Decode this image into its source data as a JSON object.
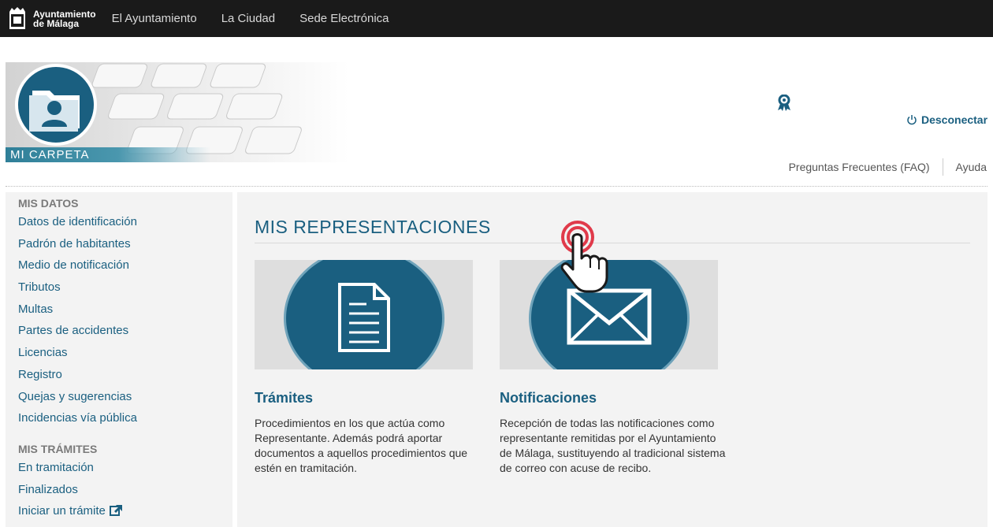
{
  "topbar": {
    "logo_line1": "Ayuntamiento",
    "logo_line2": "de Málaga",
    "nav": [
      "El Ayuntamiento",
      "La Ciudad",
      "Sede Electrónica"
    ]
  },
  "banner": {
    "label": "MI CARPETA"
  },
  "header": {
    "logout": "Desconectar",
    "faq": "Preguntas Frecuentes (FAQ)",
    "help": "Ayuda"
  },
  "sidebar": {
    "section1": "MIS DATOS",
    "items1": [
      "Datos de identificación",
      "Padrón de habitantes",
      "Medio de notificación",
      "Tributos",
      "Multas",
      "Partes de accidentes",
      "Licencias",
      "Registro",
      "Quejas y sugerencias",
      "Incidencias vía pública"
    ],
    "section2": "MIS TRÁMITES",
    "items2": [
      "En tramitación",
      "Finalizados",
      "Iniciar un trámite"
    ]
  },
  "main": {
    "title": "MIS REPRESENTACIONES",
    "cards": [
      {
        "title": "Trámites",
        "desc": "Procedimientos en los que actúa como Representante. Además podrá aportar documentos a aquellos procedimientos que estén en tramitación.",
        "icon": "document-icon"
      },
      {
        "title": "Notificaciones",
        "desc": "Recepción de todas las notificaciones como representante remitidas por el Ayuntamiento de Málaga, sustituyendo al tradicional sistema de correo con acuse de recibo.",
        "icon": "envelope-icon"
      }
    ]
  },
  "colors": {
    "brand": "#1a5f80",
    "topbar": "#1a1a1a",
    "panel": "#f3f3f3"
  }
}
